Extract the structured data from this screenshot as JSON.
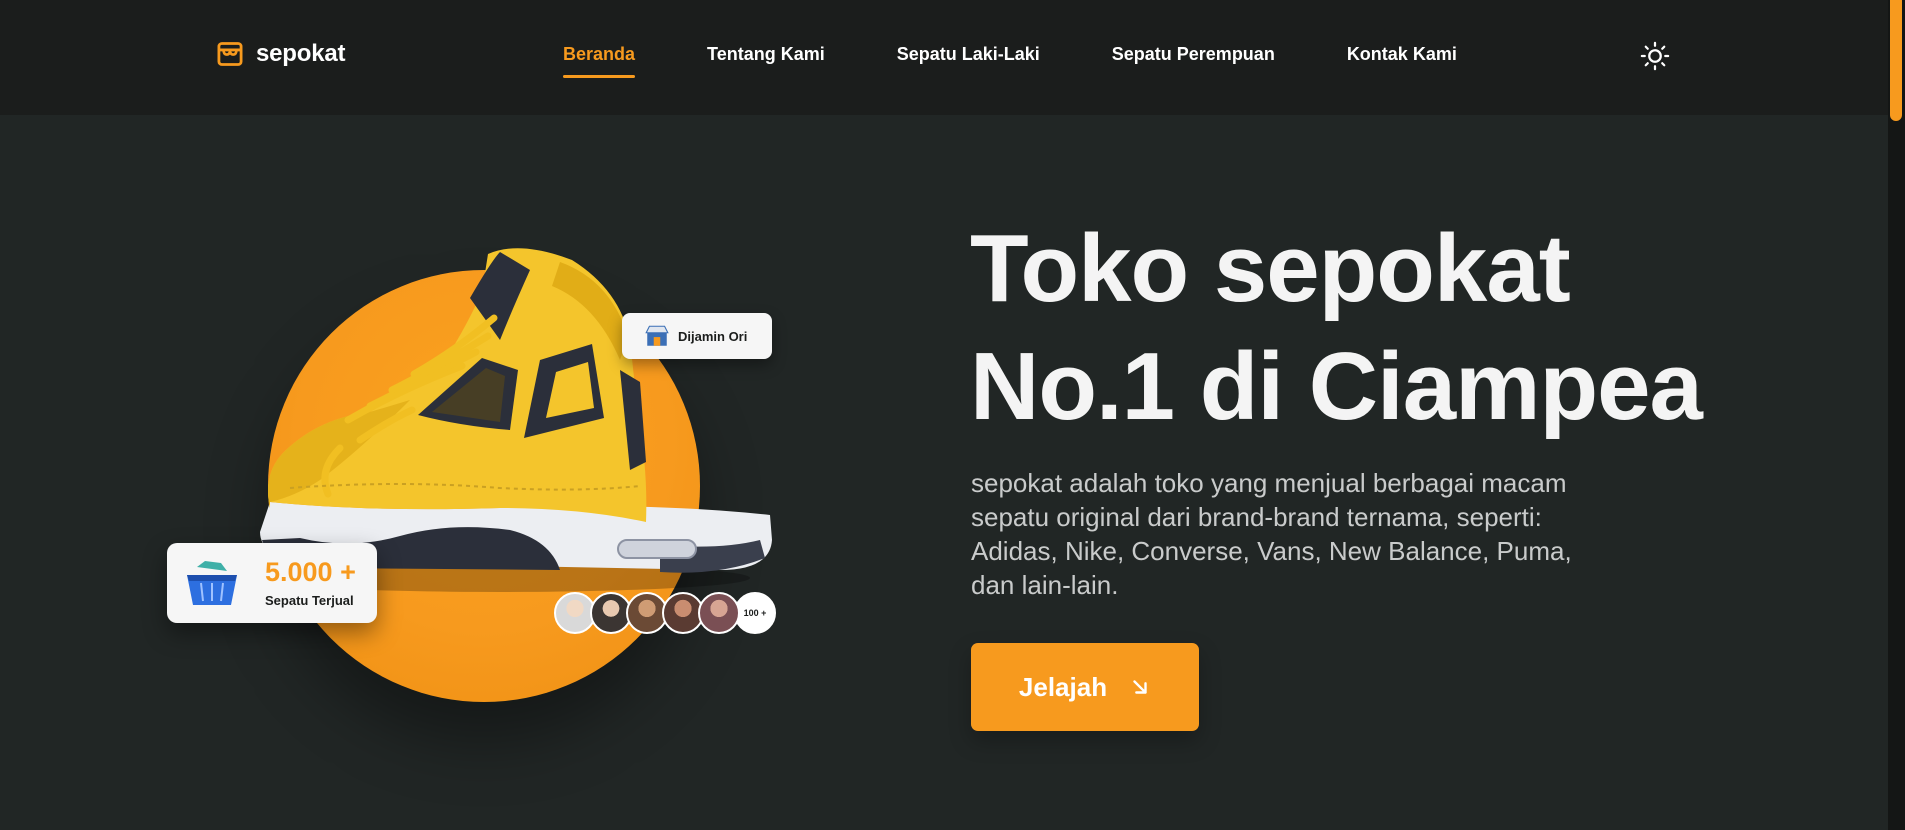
{
  "header": {
    "brand": "sepokat",
    "nav": [
      "Beranda",
      "Tentang Kami",
      "Sepatu Laki-Laki",
      "Sepatu Perempuan",
      "Kontak Kami"
    ],
    "active_nav": "Beranda",
    "theme_icon": "sun-icon"
  },
  "hero": {
    "title_line1": "Toko sepokat",
    "title_line2": "No.1 di Ciampea",
    "description": "sepokat adalah toko yang menjual berbagai macam sepatu original dari brand-brand ternama, seperti: Adidas, Nike, Converse, Vans, New Balance, Puma, dan lain-lain.",
    "cta_label": "Jelajah",
    "cta_icon": "arrow-down-right-icon"
  },
  "visual": {
    "badge_original": "Dijamin Ori",
    "sold_count": "5.000 +",
    "sold_label": "Sepatu Terjual",
    "customers_more": "100 +"
  },
  "colors": {
    "accent": "#f79a1e",
    "background": "#212625",
    "header": "#1b1d1c"
  }
}
